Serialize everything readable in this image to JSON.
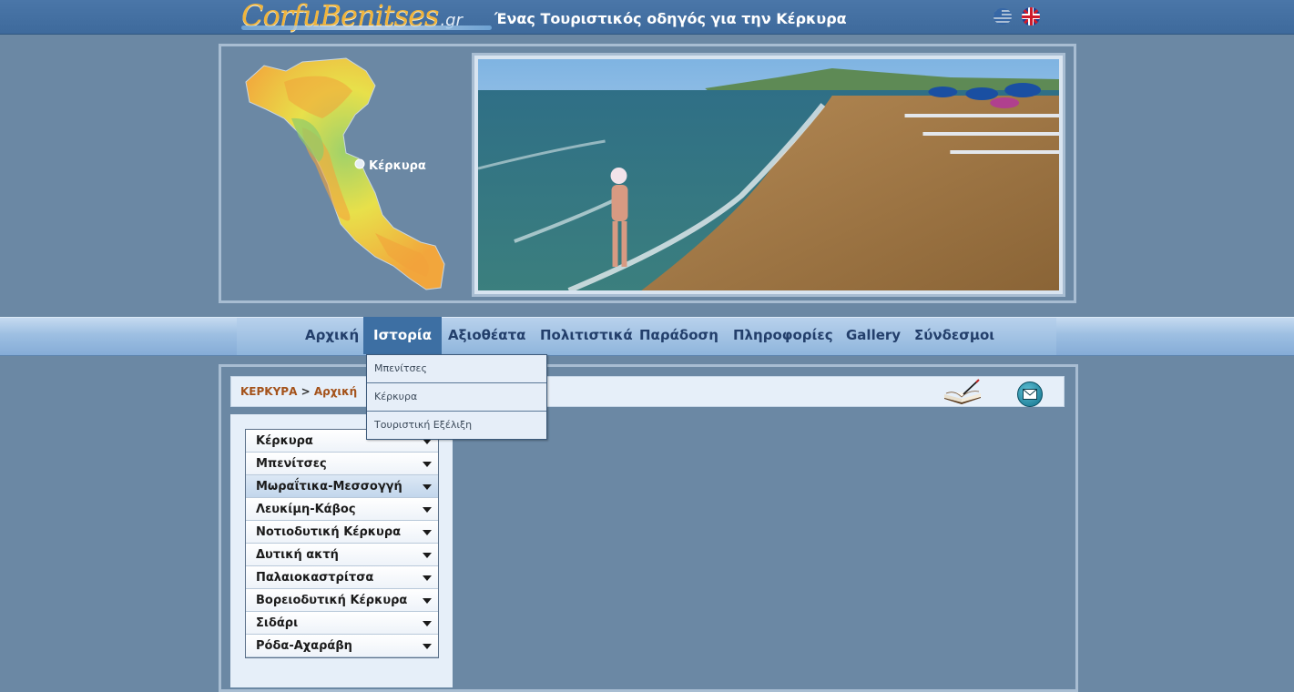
{
  "header": {
    "logo_main": "CorfuBenitses",
    "logo_suffix": ".gr",
    "tagline": "Ένας Τουριστικός οδηγός για την Κέρκυρα",
    "languages": [
      "Ελληνικά",
      "English"
    ]
  },
  "banner": {
    "map_label": "Κέρκυρα",
    "photo_subject": "beach"
  },
  "nav": {
    "items": [
      "Αρχική",
      "Ιστορία",
      "Αξιοθέατα",
      "Πολιτιστικά",
      "Παράδοση",
      "Πληροφορίες",
      "Gallery",
      "Σύνδεσμοι"
    ],
    "active": "Ιστορία",
    "dropdown": [
      "Μπενίτσες",
      "Κέρκυρα",
      "Τουριστική Εξέλιξη"
    ]
  },
  "breadcrumb": {
    "root": "ΚΕΡΚΥΡΑ",
    "separator": ">",
    "current": "Αρχική"
  },
  "toolbar": {
    "icons": [
      "guestbook-icon",
      "email-icon"
    ]
  },
  "sidebar": {
    "items": [
      "Κέρκυρα",
      "Μπενίτσες",
      "Μωραΐτικα-Μεσσογγή",
      "Λευκίμη-Κάβος",
      "Νοτιοδυτική Κέρκυρα",
      "Δυτική ακτή",
      "Παλαιοκαστρίτσα",
      "Βορειοδυτική Κέρκυρα",
      "Σιδάρι",
      "Ρόδα-Αχαράβη"
    ],
    "highlighted": "Μωραΐτικα-Μεσσογγή"
  },
  "colors": {
    "page_bg": "#6b88a4",
    "topbar": "#4a76a8",
    "nav_active": "#3d6fa3",
    "crumb": "#a4521a"
  }
}
